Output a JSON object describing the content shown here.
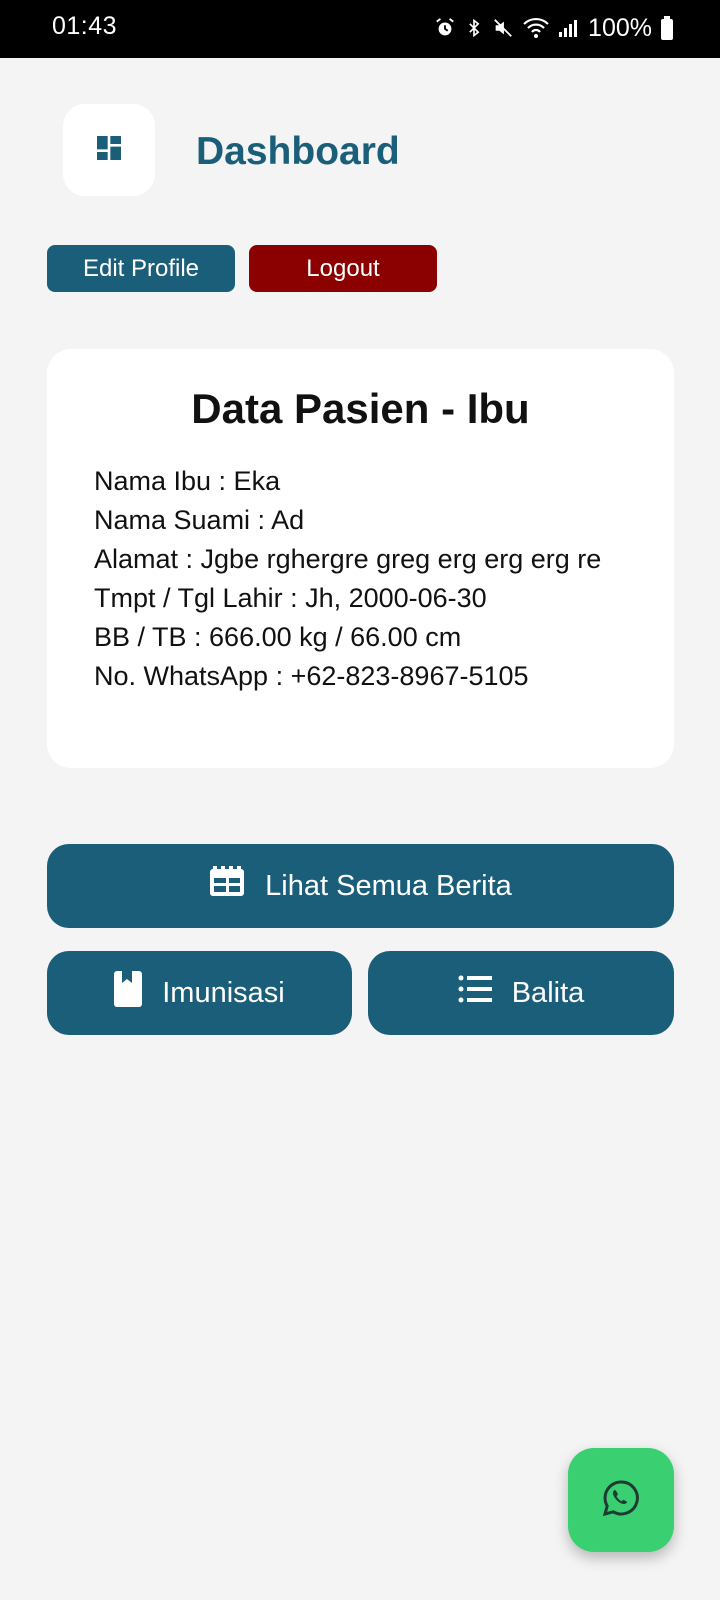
{
  "status_bar": {
    "time": "01:43",
    "battery": "100%",
    "icons": [
      "alarm-icon",
      "bluetooth-icon",
      "mute-icon",
      "wifi-icon",
      "signal-icon",
      "battery-icon"
    ]
  },
  "header": {
    "title": "Dashboard",
    "icon": "dashboard-icon"
  },
  "actions": {
    "edit_profile": "Edit Profile",
    "logout": "Logout"
  },
  "patient_card": {
    "title": "Data Pasien - Ibu",
    "lines": [
      "Nama Ibu : Eka",
      "Nama Suami : Ad",
      "Alamat : Jgbe rghergre greg erg erg erg re",
      "Tmpt / Tgl Lahir : Jh, 2000-06-30",
      "BB / TB : 666.00 kg / 66.00 cm",
      "No. WhatsApp : +62-823-8967-5105"
    ]
  },
  "menu": {
    "news": {
      "label": "Lihat Semua Berita",
      "icon": "newspaper-icon"
    },
    "imunisasi": {
      "label": "Imunisasi",
      "icon": "bookmark-book-icon"
    },
    "balita": {
      "label": "Balita",
      "icon": "list-icon"
    }
  },
  "fab": {
    "icon": "whatsapp-icon"
  },
  "colors": {
    "primary": "#1b5e7a",
    "danger": "#8b0000",
    "whatsapp": "#3ad072",
    "background": "#f4f4f4"
  }
}
